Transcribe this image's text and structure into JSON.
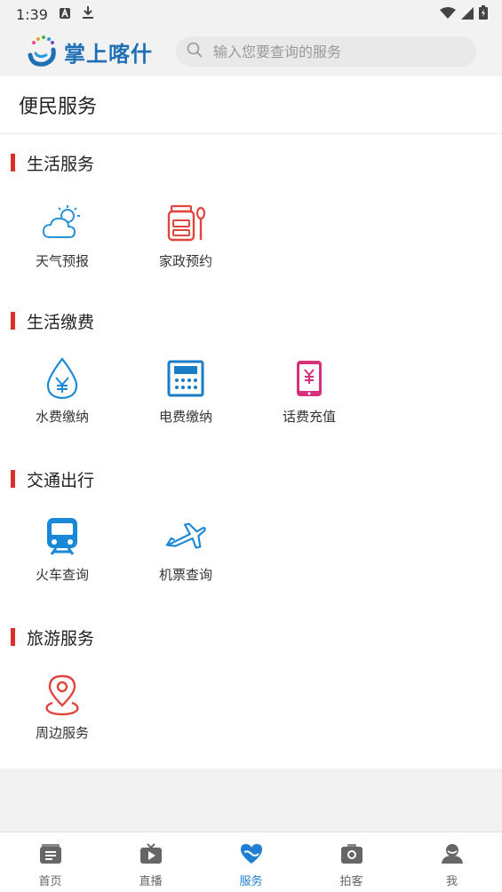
{
  "status_bar": {
    "time": "1:39"
  },
  "header": {
    "logo_text": "掌上喀什",
    "search_placeholder": "输入您要查询的服务"
  },
  "page": {
    "title": "便民服务"
  },
  "sections": [
    {
      "title": "生活服务",
      "items": [
        {
          "label": "天气预报",
          "icon": "weather-icon"
        },
        {
          "label": "家政预约",
          "icon": "housekeeping-icon"
        }
      ]
    },
    {
      "title": "生活缴费",
      "items": [
        {
          "label": "水费缴纳",
          "icon": "water-bill-icon"
        },
        {
          "label": "电费缴纳",
          "icon": "electricity-bill-icon"
        },
        {
          "label": "话费充值",
          "icon": "phone-recharge-icon"
        }
      ]
    },
    {
      "title": "交通出行",
      "items": [
        {
          "label": "火车查询",
          "icon": "train-icon"
        },
        {
          "label": "机票查询",
          "icon": "airplane-icon"
        }
      ]
    },
    {
      "title": "旅游服务",
      "items": [
        {
          "label": "周边服务",
          "icon": "location-pin-icon"
        }
      ]
    }
  ],
  "tabs": [
    {
      "label": "首页",
      "icon": "home-icon",
      "active": false
    },
    {
      "label": "直播",
      "icon": "live-tv-icon",
      "active": false
    },
    {
      "label": "服务",
      "icon": "heart-service-icon",
      "active": true
    },
    {
      "label": "拍客",
      "icon": "camera-icon",
      "active": false
    },
    {
      "label": "我",
      "icon": "user-icon",
      "active": false
    }
  ],
  "colors": {
    "accent": "#1f7fd1",
    "section_bar": "#d9302b",
    "water_blue": "#1a88d8",
    "housekeeping_red": "#e0463f",
    "phone_magenta": "#d6307f"
  }
}
